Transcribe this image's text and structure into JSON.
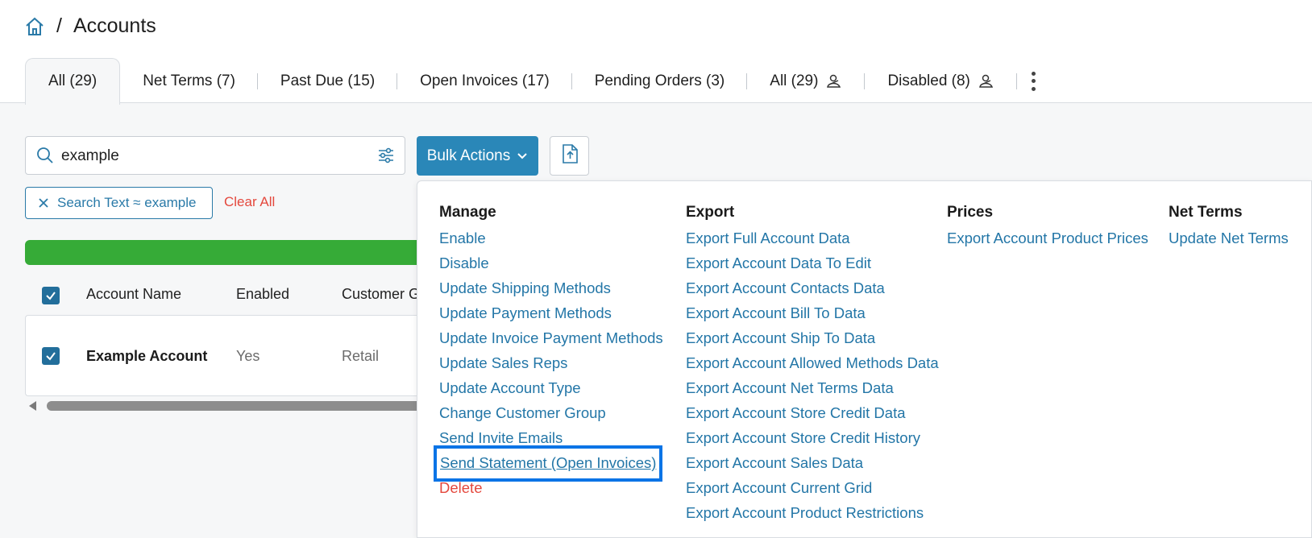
{
  "breadcrumb": {
    "separator": "/",
    "title": "Accounts"
  },
  "tabs": [
    {
      "label": "All (29)",
      "active": true
    },
    {
      "label": "Net Terms (7)"
    },
    {
      "label": "Past Due (15)"
    },
    {
      "label": "Open Invoices (17)"
    },
    {
      "label": "Pending Orders (3)"
    },
    {
      "label": "All (29)",
      "icon": "user-group-icon"
    },
    {
      "label": "Disabled (8)",
      "icon": "user-group-icon"
    }
  ],
  "search": {
    "value": "example"
  },
  "toolbar": {
    "bulk_label": "Bulk Actions"
  },
  "filters": {
    "chip_label": "Search Text ≈ example",
    "clear_label": "Clear All"
  },
  "table": {
    "columns": [
      "Account Name",
      "Enabled",
      "Customer G"
    ],
    "rows": [
      {
        "name": "Example Account",
        "enabled": "Yes",
        "group": "Retail"
      }
    ]
  },
  "menu": {
    "manage": {
      "title": "Manage",
      "items": [
        "Enable",
        "Disable",
        "Update Shipping Methods",
        "Update Payment Methods",
        "Update Invoice Payment Methods",
        "Update Sales Reps",
        "Update Account Type",
        "Change Customer Group",
        "Send Invite Emails",
        "Send Statement (Open Invoices)",
        "Delete"
      ]
    },
    "export": {
      "title": "Export",
      "items": [
        "Export Full Account Data",
        "Export Account Data To Edit",
        "Export Account Contacts Data",
        "Export Account Bill To Data",
        "Export Account Ship To Data",
        "Export Account Allowed Methods Data",
        "Export Account Net Terms Data",
        "Export Account Store Credit Data",
        "Export Account Store Credit History",
        "Export Account Sales Data",
        "Export Account Current Grid",
        "Export Account Product Restrictions"
      ]
    },
    "prices": {
      "title": "Prices",
      "items": [
        "Export Account Product Prices"
      ]
    },
    "net_terms": {
      "title": "Net Terms",
      "items": [
        "Update Net Terms"
      ]
    }
  },
  "colors": {
    "accent": "#2a87b8",
    "link": "#2376a7",
    "danger": "#e4483d",
    "progress": "#36ab37",
    "highlight": "#0a74e6"
  }
}
